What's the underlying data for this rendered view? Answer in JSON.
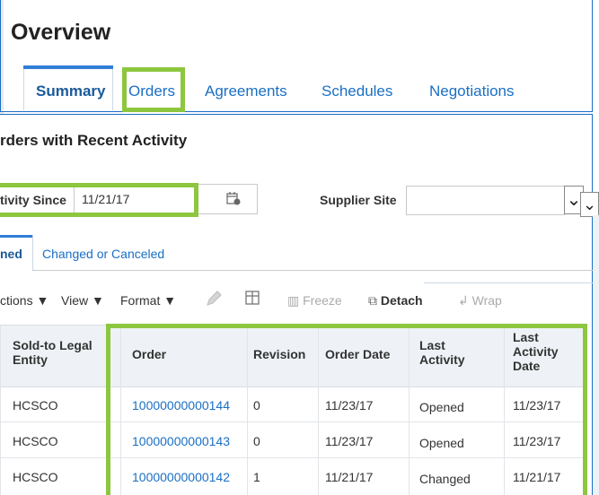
{
  "overview": {
    "title": "Overview",
    "tabs": [
      "Summary",
      "Orders",
      "Agreements",
      "Schedules",
      "Negotiations"
    ]
  },
  "recent": {
    "title": "rders with Recent Activity",
    "activity_label": "tivity Since",
    "activity_value": "11/21/17",
    "supplier_label": "Supplier Site",
    "supplier_value": ""
  },
  "subtabs": [
    "ned",
    "Changed or Canceled"
  ],
  "toolbar": {
    "actions": "ctions ▼",
    "view": "View ▼",
    "format": "Format ▼",
    "freeze": "Freeze",
    "detach": "Detach",
    "wrap": "Wrap"
  },
  "table": {
    "headers": {
      "sold_to": "Sold-to Legal Entity",
      "order": "Order",
      "revision": "Revision",
      "order_date": "Order Date",
      "last_activity": "Last Activity",
      "last_activity_date": "Last Activity Date"
    },
    "rows": [
      {
        "sold_to": "HCSCO",
        "order": "10000000000144",
        "revision": "0",
        "order_date": "11/23/17",
        "last_activity": "Opened",
        "last_activity_date": "11/23/17"
      },
      {
        "sold_to": "HCSCO",
        "order": "10000000000143",
        "revision": "0",
        "order_date": "11/23/17",
        "last_activity": "Opened",
        "last_activity_date": "11/23/17"
      },
      {
        "sold_to": "HCSCO",
        "order": "10000000000142",
        "revision": "1",
        "order_date": "11/21/17",
        "last_activity": "Changed",
        "last_activity_date": "11/21/17"
      }
    ]
  },
  "colors": {
    "accent": "#1a6fc4",
    "highlight": "#8dc63f"
  }
}
